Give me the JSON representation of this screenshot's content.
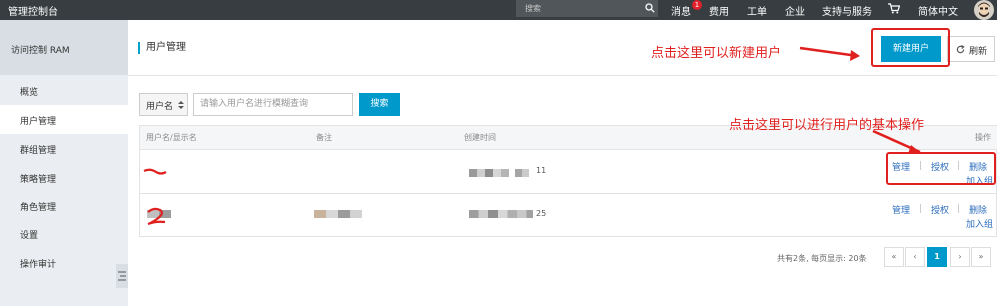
{
  "topbar": {
    "brand": "管理控制台",
    "search_placeholder": "搜索",
    "nav": [
      "消息",
      "费用",
      "工单",
      "企业",
      "支持与服务",
      "简体中文"
    ],
    "message_badge": "1"
  },
  "sidebar": {
    "title": "访问控制 RAM",
    "items": [
      "概览",
      "用户管理",
      "群组管理",
      "策略管理",
      "角色管理",
      "设置",
      "操作审计"
    ],
    "active_index": 1
  },
  "header": {
    "page_title": "用户管理",
    "new_user_button": "新建用户",
    "refresh_button": "刷新"
  },
  "filter": {
    "select_label": "用户名",
    "input_placeholder": "请输入用户名进行模糊查询",
    "search_button": "搜索"
  },
  "table": {
    "columns": [
      "用户名/显示名",
      "备注",
      "创建时间",
      "操作"
    ],
    "rows": [
      {
        "created_suffix": "11",
        "ops": [
          "管理",
          "授权",
          "删除",
          "加入组"
        ]
      },
      {
        "created_suffix": "25",
        "ops": [
          "管理",
          "授权",
          "删除",
          "加入组"
        ]
      }
    ]
  },
  "pagination": {
    "info": "共有2条, 每页显示: 20条",
    "buttons": [
      "«",
      "‹",
      "1",
      "›",
      "»"
    ],
    "current": "1"
  },
  "annotations": {
    "new_user_hint": "点击这里可以新建用户",
    "ops_hint": "点击这里可以进行用户的基本操作"
  },
  "colors": {
    "topbar": "#373d41",
    "accent": "#0099cc",
    "link": "#2d6ebd",
    "annotation_red": "#e0201e"
  }
}
